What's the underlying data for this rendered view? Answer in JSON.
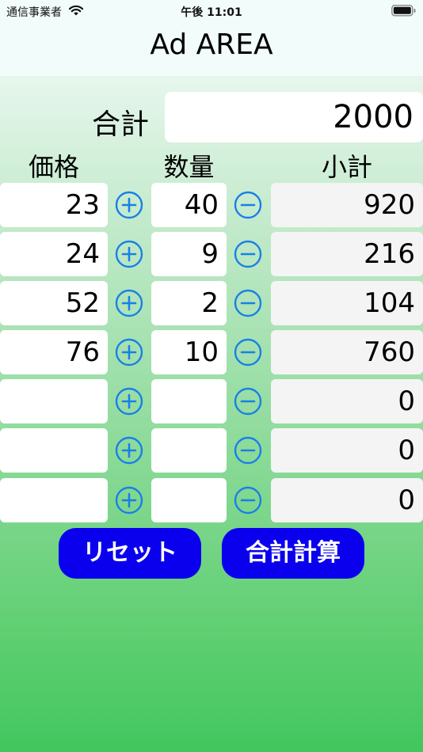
{
  "status": {
    "carrier": "通信事業者",
    "time": "午後 11:01"
  },
  "title": "Ad AREA",
  "total": {
    "label": "合計",
    "value": "2000"
  },
  "headers": {
    "price": "価格",
    "qty": "数量",
    "subtotal": "小計"
  },
  "rows": [
    {
      "price": "23",
      "qty": "40",
      "subtotal": "920"
    },
    {
      "price": "24",
      "qty": "9",
      "subtotal": "216"
    },
    {
      "price": "52",
      "qty": "2",
      "subtotal": "104"
    },
    {
      "price": "76",
      "qty": "10",
      "subtotal": "760"
    },
    {
      "price": "",
      "qty": "",
      "subtotal": "0"
    },
    {
      "price": "",
      "qty": "",
      "subtotal": "0"
    },
    {
      "price": "",
      "qty": "",
      "subtotal": "0"
    }
  ],
  "buttons": {
    "reset": "リセット",
    "calc": "合計計算"
  },
  "colors": {
    "accent": "#1a7fe8",
    "button": "#0a00ee"
  },
  "icons": {
    "plus": "plus-circle-icon",
    "minus": "minus-circle-icon"
  }
}
